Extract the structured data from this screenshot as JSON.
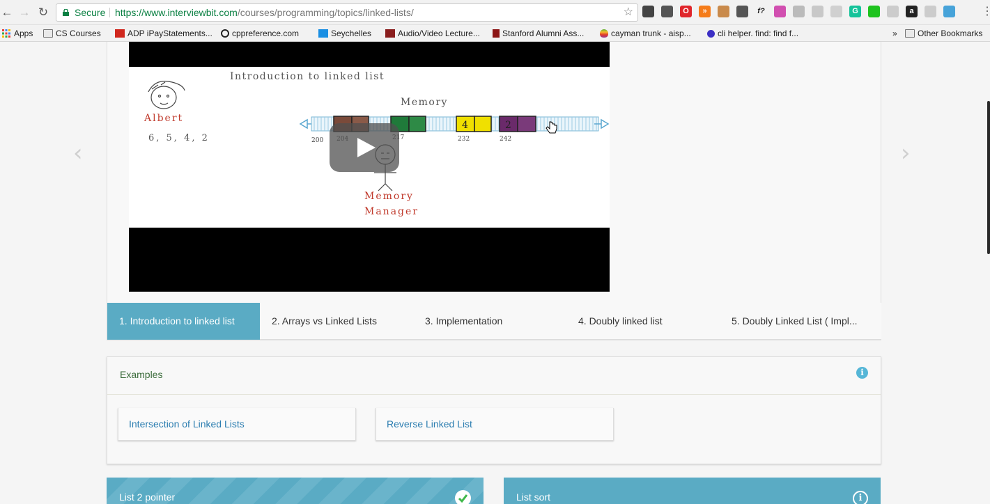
{
  "browser": {
    "secure_label": "Secure",
    "url_host": "https://www.interviewbit.com",
    "url_path": "/courses/programming/topics/linked-lists/",
    "extensions": [
      {
        "name": "extension-1-icon",
        "color": "#444444",
        "glyph": ""
      },
      {
        "name": "extension-2-icon",
        "color": "#555555",
        "glyph": ""
      },
      {
        "name": "opera-icon",
        "color": "#e0262b",
        "glyph": "O"
      },
      {
        "name": "extension-4-icon",
        "color": "#f57c1a",
        "glyph": "»"
      },
      {
        "name": "extension-5-icon",
        "color": "#c98a4b",
        "glyph": ""
      },
      {
        "name": "pocket-icon",
        "color": "#555555",
        "glyph": ""
      },
      {
        "name": "function-icon",
        "color": "#f2f2f2",
        "glyph": "f?"
      },
      {
        "name": "color-wheel-icon",
        "color": "#d14fb0",
        "glyph": ""
      },
      {
        "name": "extension-9-icon",
        "color": "#bbbbbb",
        "glyph": ""
      },
      {
        "name": "extension-10-icon",
        "color": "#c8c8c8",
        "glyph": ""
      },
      {
        "name": "github-icon",
        "color": "#d0d0d0",
        "glyph": ""
      },
      {
        "name": "grammarly-icon",
        "color": "#15c39a",
        "glyph": "G"
      },
      {
        "name": "green-dot-icon",
        "color": "#1ec31e",
        "glyph": ""
      },
      {
        "name": "extension-14-icon",
        "color": "#cccccc",
        "glyph": ""
      },
      {
        "name": "extension-15-icon",
        "color": "#222222",
        "glyph": "a"
      },
      {
        "name": "extension-16-icon",
        "color": "#cccccc",
        "glyph": ""
      },
      {
        "name": "extension-17-icon",
        "color": "#47a3d9",
        "glyph": ""
      }
    ]
  },
  "bookmarks": {
    "apps": "Apps",
    "items": [
      {
        "label": "CS Courses",
        "icon": "folder-icon"
      },
      {
        "label": "ADP iPayStatements...",
        "icon": "adp-icon"
      },
      {
        "label": "cppreference.com",
        "icon": "cppreference-icon"
      },
      {
        "label": "Seychelles",
        "icon": "seychelles-icon"
      },
      {
        "label": "Audio/Video Lecture...",
        "icon": "mit-icon"
      },
      {
        "label": "Stanford Alumni Ass...",
        "icon": "stanford-icon"
      },
      {
        "label": "cayman trunk - aisp...",
        "icon": "apple-icon"
      },
      {
        "label": "cli helper. find: find f...",
        "icon": "dot-icon"
      }
    ],
    "overflow": "»",
    "other": "Other Bookmarks"
  },
  "video": {
    "whiteboard": {
      "title": "Introduction to linked list",
      "person_name": "Albert",
      "person_numbers": "6, 5, 4, 2",
      "memory_label": "Memory",
      "manager_label_1": "Memory",
      "manager_label_2": "Manager",
      "addresses": [
        "200",
        "204",
        "217",
        "232",
        "242"
      ],
      "cell_values": [
        "4",
        "2"
      ]
    }
  },
  "tabs": [
    {
      "label": "1. Introduction to linked list",
      "active": true
    },
    {
      "label": "2. Arrays vs Linked Lists",
      "active": false
    },
    {
      "label": "3. Implementation",
      "active": false
    },
    {
      "label": "4. Doubly linked list",
      "active": false
    },
    {
      "label": "5. Doubly Linked List ( Impl...",
      "active": false
    }
  ],
  "examples": {
    "title": "Examples",
    "items": [
      "Intersection of Linked Lists",
      "Reverse Linked List"
    ]
  },
  "problems": [
    {
      "title": "List 2 pointer",
      "status": "solved"
    },
    {
      "title": "List sort",
      "status": "info"
    }
  ],
  "colors": {
    "accent": "#5aabc4",
    "info": "#55b6d7",
    "secure_green": "#0b8043",
    "link": "#2b7db0"
  }
}
